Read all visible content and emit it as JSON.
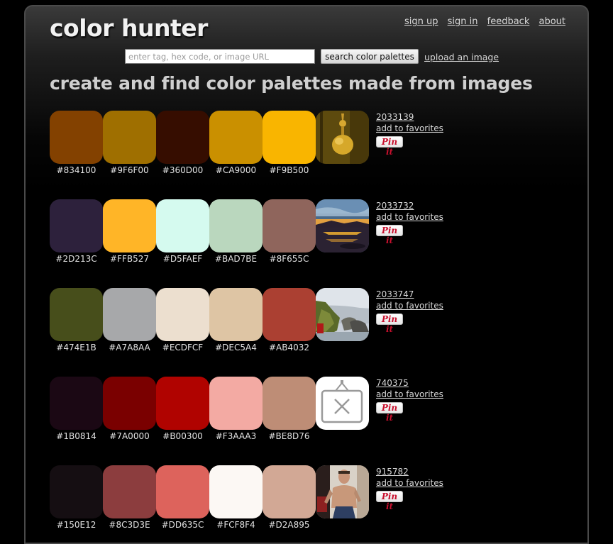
{
  "site": {
    "logo": "color hunter",
    "tagline": "create and find color palettes made from images"
  },
  "nav": {
    "sign_up": "sign up",
    "sign_in": "sign in",
    "feedback": "feedback",
    "about": "about"
  },
  "search": {
    "placeholder": "enter tag, hex code, or image URL",
    "value": "",
    "button_label": "search color palettes",
    "upload_link": "upload an image"
  },
  "palettes": [
    {
      "id": "2033139",
      "favorite_label": "add to favorites",
      "pin_label": "Pin it",
      "thumbnail_icon": "photo-ornament-icon",
      "colors": [
        {
          "hex": "#834100",
          "label": "#834100"
        },
        {
          "hex": "#9F6F00",
          "label": "#9F6F00"
        },
        {
          "hex": "#360D00",
          "label": "#360D00"
        },
        {
          "hex": "#CA9000",
          "label": "#CA9000"
        },
        {
          "hex": "#F9B500",
          "label": "#F9B500"
        }
      ]
    },
    {
      "id": "2033732",
      "favorite_label": "add to favorites",
      "pin_label": "Pin it",
      "thumbnail_icon": "photo-sunset-lake-icon",
      "colors": [
        {
          "hex": "#2D213C",
          "label": "#2D213C"
        },
        {
          "hex": "#FFB527",
          "label": "#FFB527"
        },
        {
          "hex": "#D5FAEF",
          "label": "#D5FAEF"
        },
        {
          "hex": "#BAD7BE",
          "label": "#BAD7BE"
        },
        {
          "hex": "#8F655C",
          "label": "#8F655C"
        }
      ]
    },
    {
      "id": "2033747",
      "favorite_label": "add to favorites",
      "pin_label": "Pin it",
      "thumbnail_icon": "photo-coastline-icon",
      "colors": [
        {
          "hex": "#474E1B",
          "label": "#474E1B"
        },
        {
          "hex": "#A7A8AA",
          "label": "#A7A8AA"
        },
        {
          "hex": "#ECDFCF",
          "label": "#ECDFCF"
        },
        {
          "hex": "#DEC5A4",
          "label": "#DEC5A4"
        },
        {
          "hex": "#AB4032",
          "label": "#AB4032"
        }
      ]
    },
    {
      "id": "740375",
      "favorite_label": "add to favorites",
      "pin_label": "Pin it",
      "thumbnail_icon": "broken-image-icon",
      "colors": [
        {
          "hex": "#1B0814",
          "label": "#1B0814"
        },
        {
          "hex": "#7A0000",
          "label": "#7A0000"
        },
        {
          "hex": "#B00300",
          "label": "#B00300"
        },
        {
          "hex": "#F3AAA3",
          "label": "#F3AAA3"
        },
        {
          "hex": "#BE8D76",
          "label": "#BE8D76"
        }
      ]
    },
    {
      "id": "915782",
      "favorite_label": "add to favorites",
      "pin_label": "Pin it",
      "thumbnail_icon": "photo-person-icon",
      "colors": [
        {
          "hex": "#150E12",
          "label": "#150E12"
        },
        {
          "hex": "#8C3D3E",
          "label": "#8C3D3E"
        },
        {
          "hex": "#DD635C",
          "label": "#DD635C"
        },
        {
          "hex": "#FCF8F4",
          "label": "#FCF8F4"
        },
        {
          "hex": "#D2A895",
          "label": "#D2A895"
        }
      ]
    }
  ]
}
